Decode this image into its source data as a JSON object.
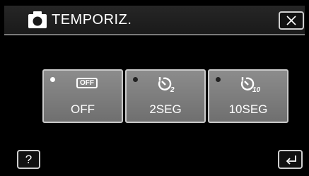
{
  "header": {
    "title": "TEMPORIZ.",
    "mode_icon": "camera-icon",
    "close_icon": "close-icon"
  },
  "options": [
    {
      "id": "off",
      "badge": "OFF",
      "label": "OFF",
      "selected": true,
      "icon": "timer-off-icon"
    },
    {
      "id": "2s",
      "label": "2SEG",
      "selected": false,
      "icon": "timer-2s-icon"
    },
    {
      "id": "10s",
      "label": "10SEG",
      "selected": false,
      "icon": "timer-10s-icon"
    }
  ],
  "footer": {
    "help_label": "?",
    "back_icon": "return-icon"
  },
  "colors": {
    "background": "#000000",
    "button_fill": "#7f7f7f",
    "button_border": "#c9c9c9",
    "text": "#ffffff"
  }
}
